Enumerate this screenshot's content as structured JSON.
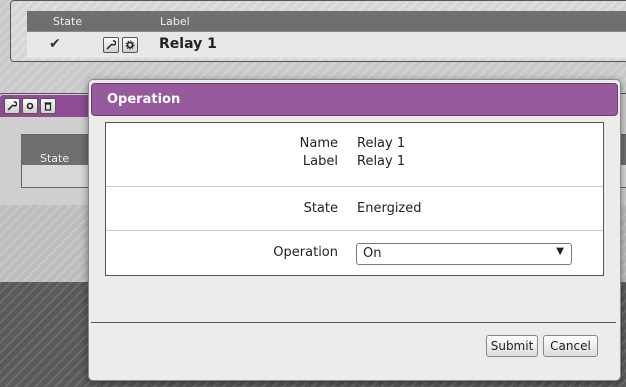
{
  "background": {
    "top_panel": {
      "headers": {
        "state": "State",
        "label": "Label"
      },
      "row": {
        "state_icon": "checkmark-icon",
        "label": "Relay 1"
      }
    },
    "mid_panel": {
      "state_header": "State"
    }
  },
  "modal": {
    "title": "Operation",
    "fields": {
      "name": {
        "label": "Name",
        "value": "Relay 1"
      },
      "label": {
        "label": "Label",
        "value": "Relay 1"
      },
      "state": {
        "label": "State",
        "value": "Energized"
      },
      "operation": {
        "label": "Operation",
        "selected": "On"
      }
    },
    "buttons": {
      "submit": "Submit",
      "cancel": "Cancel"
    }
  },
  "colors": {
    "accent": "#975a9d",
    "header_dark": "#6f6f6f"
  }
}
